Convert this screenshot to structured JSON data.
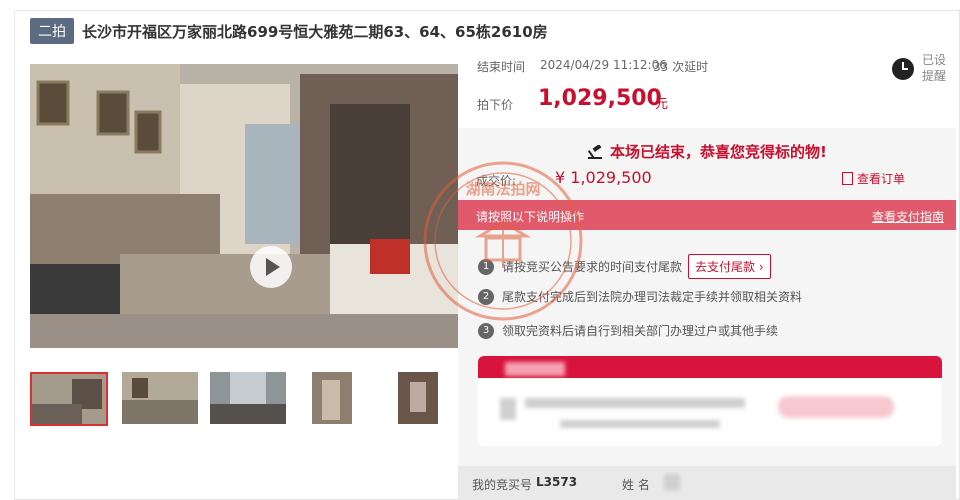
{
  "header": {
    "round_badge": "二拍",
    "title": "长沙市开福区万家丽北路699号恒大雅苑二期63、64、65栋2610房"
  },
  "auction": {
    "end_time_label": "结束时间",
    "end_time": "2024/04/29 11:12:06",
    "delay_count": "33 次延时",
    "price_label": "拍下价",
    "price": "1,029,500",
    "price_unit": "元",
    "remind_text": "已设提醒"
  },
  "result": {
    "headline": "本场已结束，恭喜您竞得标的物!",
    "deal_label": "成交价:",
    "deal_price": "¥ 1,029,500",
    "order_link": "查看订单",
    "instruction": "请按照以下说明操作",
    "payment_guide_link": "查看支付指南",
    "steps": [
      {
        "num": "1",
        "text": "请按竞买公告要求的时间支付尾款",
        "button": "去支付尾款 ›"
      },
      {
        "num": "2",
        "text": "尾款支付完成后到法院办理司法裁定手续并领取相关资料"
      },
      {
        "num": "3",
        "text": "领取完资料后请自行到相关部门办理过户或其他手续"
      }
    ]
  },
  "bidder": {
    "number_label": "我的竞买号",
    "number": "L3573",
    "name_label": "姓 名"
  },
  "seal": {
    "text": "湖南法拍网"
  },
  "colors": {
    "accent": "#c8102e",
    "instruction_bar": "#e05a6c",
    "badge": "#5b6b82"
  }
}
